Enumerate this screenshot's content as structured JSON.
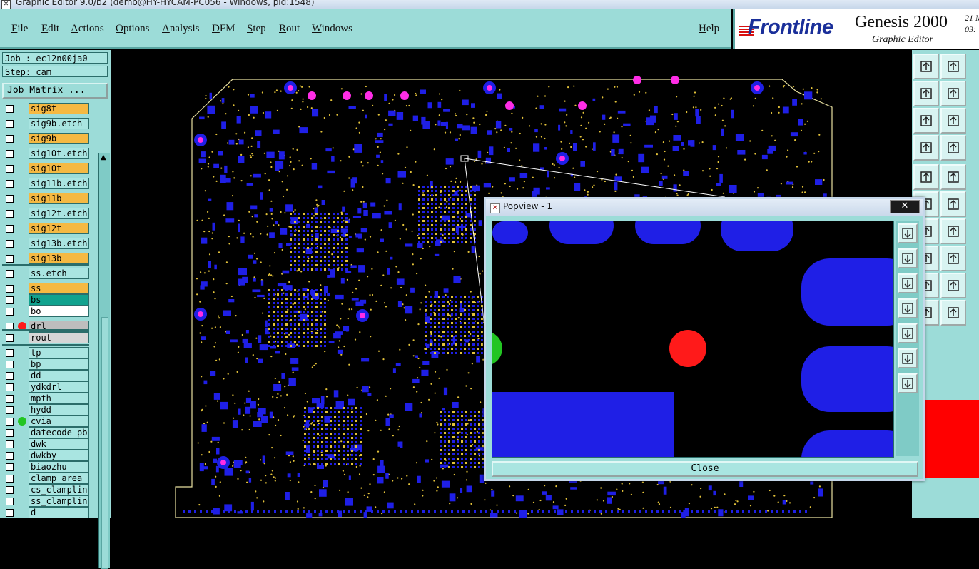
{
  "window": {
    "title": "Graphic Editor 9.0/b2 (demo@HY-HYCAM-PC056 - Windows, pid:1548)"
  },
  "menu": {
    "items": [
      "File",
      "Edit",
      "Actions",
      "Options",
      "Analysis",
      "DFM",
      "Step",
      "Rout",
      "Windows"
    ],
    "help": "Help"
  },
  "logo": {
    "brand": "Frontline",
    "product": "Genesis 2000",
    "subtitle": "Graphic Editor",
    "time_line1": "21 M",
    "time_line2": "03:"
  },
  "job": {
    "job": "Job : ec12n00ja0",
    "step": "Step: cam",
    "matrix_button": "Job Matrix ..."
  },
  "layers": [
    {
      "name": "sig8t",
      "color": "#f5b942"
    },
    {
      "name": "sig9b.etch",
      "color": "#a9e5e1"
    },
    {
      "name": "sig9b",
      "color": "#f5b942"
    },
    {
      "name": "sig10t.etch",
      "color": "#a9e5e1"
    },
    {
      "name": "sig10t",
      "color": "#f5b942"
    },
    {
      "name": "sig11b.etch",
      "color": "#a9e5e1"
    },
    {
      "name": "sig11b",
      "color": "#f5b942"
    },
    {
      "name": "sig12t.etch",
      "color": "#a9e5e1"
    },
    {
      "name": "sig12t",
      "color": "#f5b942"
    },
    {
      "name": "sig13b.etch",
      "color": "#a9e5e1"
    },
    {
      "name": "sig13b",
      "color": "#f5b942"
    },
    {
      "name": "ss.etch",
      "color": "#a9e5e1"
    },
    {
      "name": "ss",
      "color": "#f5b942"
    },
    {
      "name": "bs",
      "color": "#11a28e"
    },
    {
      "name": "bo",
      "color": "#ffffff"
    },
    {
      "name": "drl",
      "color": "#bdbdbd",
      "dot": "#ff1a1a"
    },
    {
      "name": "rout",
      "color": "#d6d6d6"
    },
    {
      "name": "tp",
      "color": "#a9e5e1"
    },
    {
      "name": "bp",
      "color": "#a9e5e1"
    },
    {
      "name": "dd",
      "color": "#a9e5e1"
    },
    {
      "name": "ydkdrl",
      "color": "#a9e5e1"
    },
    {
      "name": "mpth",
      "color": "#a9e5e1"
    },
    {
      "name": "hydd",
      "color": "#a9e5e1"
    },
    {
      "name": "cvia",
      "color": "#a9e5e1",
      "dot": "#22c522"
    },
    {
      "name": "datecode-pbe",
      "color": "#a9e5e1"
    },
    {
      "name": "dwk",
      "color": "#a9e5e1"
    },
    {
      "name": "dwkby",
      "color": "#a9e5e1"
    },
    {
      "name": "biaozhu",
      "color": "#a9e5e1"
    },
    {
      "name": "clamp_area",
      "color": "#a9e5e1"
    },
    {
      "name": "cs_clampline",
      "color": "#a9e5e1"
    },
    {
      "name": "ss_clampline",
      "color": "#a9e5e1"
    },
    {
      "name": "d",
      "color": "#a9e5e1"
    }
  ],
  "popview": {
    "title": "Popview - 1",
    "close_button": "Close",
    "close_icon": "✕"
  },
  "colors": {
    "panel": "#9cdcd8",
    "copper": "#1f1fe6",
    "drill": "#ff1a1a",
    "via": "#22c522",
    "pad_pink": "#ff2de6",
    "trace": "#e3c23a"
  }
}
